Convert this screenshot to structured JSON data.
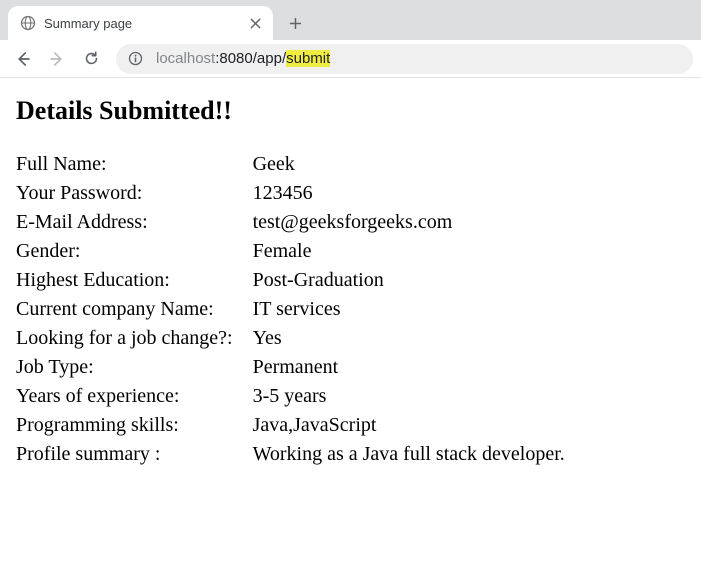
{
  "browser": {
    "tab_title": "Summary page",
    "url": {
      "host_muted": "localhost",
      "port": ":8080",
      "path_prefix": "/app/",
      "path_highlight": "submit"
    }
  },
  "page": {
    "heading": "Details Submitted!!",
    "rows": [
      {
        "label": "Full Name:",
        "value": "Geek"
      },
      {
        "label": "Your Password:",
        "value": "123456"
      },
      {
        "label": "E-Mail Address:",
        "value": "test@geeksforgeeks.com"
      },
      {
        "label": "Gender:",
        "value": "Female"
      },
      {
        "label": "Highest Education:",
        "value": "Post-Graduation"
      },
      {
        "label": "Current company Name:",
        "value": "IT services"
      },
      {
        "label": "Looking for a job change?:",
        "value": "Yes"
      },
      {
        "label": "Job Type:",
        "value": "Permanent"
      },
      {
        "label": "Years of experience:",
        "value": "3-5 years"
      },
      {
        "label": "Programming skills:",
        "value": "Java,JavaScript"
      },
      {
        "label": "Profile summary :",
        "value": "Working as a Java full stack developer."
      }
    ]
  }
}
